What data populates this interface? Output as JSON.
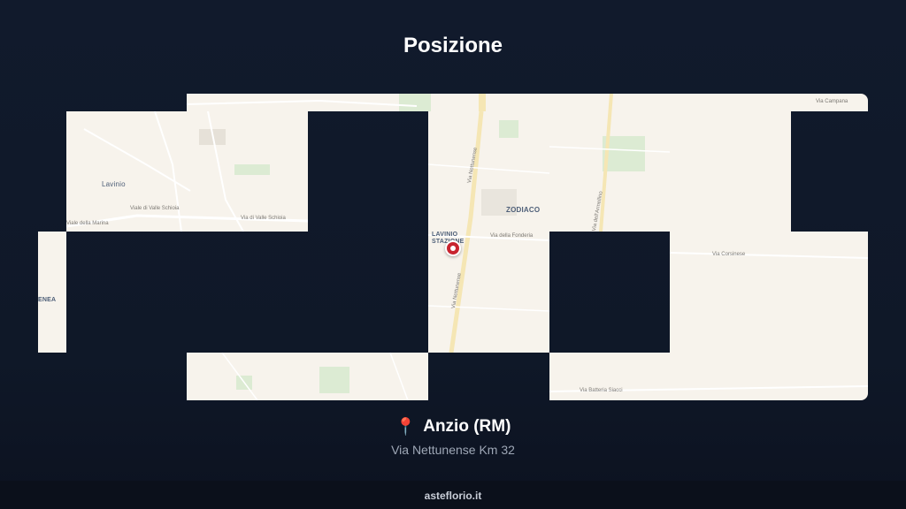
{
  "page": {
    "title": "Posizione"
  },
  "map": {
    "place_labels": [
      "Lavinio",
      "LAVINIO STAZIONE",
      "ZODIACO",
      "ENEA"
    ],
    "road_labels": [
      "Viale di Valle Schioia",
      "Via di Valle Schioia",
      "Viale della Marina",
      "Via Nettunense",
      "Via della Fonderia",
      "Via dell'Armellino",
      "Via Corsinese",
      "Via Batteria Siacci",
      "Via Campana"
    ],
    "marker_icon": "map-marker-icon",
    "colors": {
      "land": "#f7f3ec",
      "park": "#dcebd3",
      "road": "#ffffff",
      "major_road": "#f5e6b4",
      "marker": "#c8242f"
    }
  },
  "location": {
    "pin_icon": "pin-icon",
    "name": "Anzio (RM)",
    "address": "Via Nettunense Km 32"
  },
  "footer": {
    "site": "asteflorio.it"
  }
}
